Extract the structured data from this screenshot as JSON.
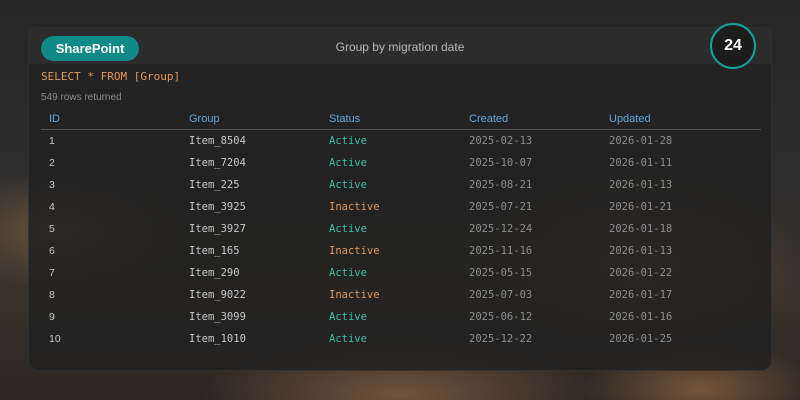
{
  "header": {
    "app_name": "SharePoint",
    "title": "Group by migration date",
    "badge_count": "24"
  },
  "query": {
    "sql": "SELECT * FROM [Group]",
    "rows_returned": "549 rows returned"
  },
  "table": {
    "columns": [
      "ID",
      "Group",
      "Status",
      "Created",
      "Updated"
    ],
    "rows": [
      {
        "id": "1",
        "group": "Item_8504",
        "status": "Active",
        "created": "2025-02-13",
        "updated": "2026-01-28"
      },
      {
        "id": "2",
        "group": "Item_7204",
        "status": "Active",
        "created": "2025-10-07",
        "updated": "2026-01-11"
      },
      {
        "id": "3",
        "group": "Item_225",
        "status": "Active",
        "created": "2025-08-21",
        "updated": "2026-01-13"
      },
      {
        "id": "4",
        "group": "Item_3925",
        "status": "Inactive",
        "created": "2025-07-21",
        "updated": "2026-01-21"
      },
      {
        "id": "5",
        "group": "Item_3927",
        "status": "Active",
        "created": "2025-12-24",
        "updated": "2026-01-18"
      },
      {
        "id": "6",
        "group": "Item_165",
        "status": "Inactive",
        "created": "2025-11-16",
        "updated": "2026-01-13"
      },
      {
        "id": "7",
        "group": "Item_290",
        "status": "Active",
        "created": "2025-05-15",
        "updated": "2026-01-22"
      },
      {
        "id": "8",
        "group": "Item_9022",
        "status": "Inactive",
        "created": "2025-07-03",
        "updated": "2026-01-17"
      },
      {
        "id": "9",
        "group": "Item_3099",
        "status": "Active",
        "created": "2025-06-12",
        "updated": "2026-01-16"
      },
      {
        "id": "10",
        "group": "Item_1010",
        "status": "Active",
        "created": "2025-12-22",
        "updated": "2026-01-25"
      }
    ]
  },
  "colors": {
    "accent": "#0f8a86",
    "badge_ring": "#12a39d",
    "status_active": "#3fbfa5",
    "status_inactive": "#e3955a",
    "header_text": "#5ea8e0",
    "query_text": "#e89a55"
  }
}
